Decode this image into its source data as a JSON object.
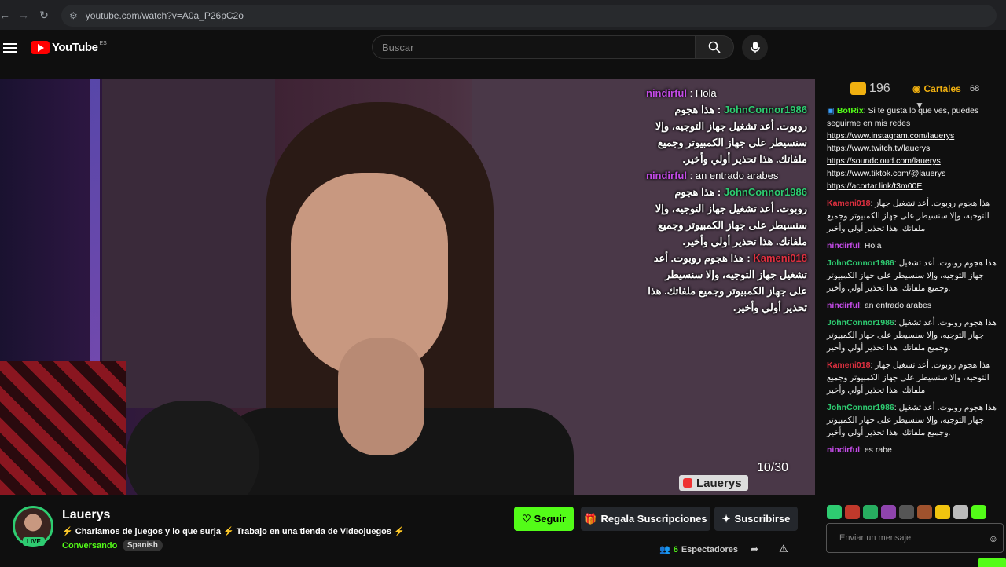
{
  "browser": {
    "url": "youtube.com/watch?v=A0a_P26pC2o"
  },
  "header": {
    "logo_text": "YouTube",
    "country": "ES",
    "search_placeholder": "Buscar"
  },
  "video_overlay": {
    "messages": [
      {
        "user": "nindirful",
        "sep": " : ",
        "text": "Hola",
        "color": "#c44be8",
        "rtl": false
      },
      {
        "user": "JohnConnor1986",
        "sep": " : ",
        "text": "هذا هجوم روبوت. أعد تشغيل جهاز التوجيه، وإلا سنسيطر على جهاز الكمبيوتر وجميع ملفاتك. هذا تحذير أولي وأخير.",
        "color": "#2ecc71",
        "rtl": true
      },
      {
        "user": "nindirful",
        "sep": " : ",
        "text": "an entrado arabes",
        "color": "#c44be8",
        "rtl": false
      },
      {
        "user": "JohnConnor1986",
        "sep": " : ",
        "text": "هذا هجوم روبوت. أعد تشغيل جهاز التوجيه، وإلا سنسيطر على جهاز الكمبيوتر وجميع ملفاتك. هذا تحذير أولي وأخير.",
        "color": "#2ecc71",
        "rtl": true
      },
      {
        "user": "Kameni018",
        "sep": " : ",
        "text": "هذا هجوم روبوت. أعد تشغيل جهاز التوجيه، وإلا سنسيطر على جهاز الكمبيوتر وجميع ملفاتك. هذا تحذير أولي وأخير.",
        "color": "#e03040",
        "rtl": true
      }
    ],
    "counter": "10/30",
    "brand": "Lauerys"
  },
  "channel": {
    "name": "Lauerys",
    "live_label": "LIVE",
    "title": "⚡ Charlamos de juegos y lo que surja ⚡ Trabajo en una tienda de Videojuegos ⚡",
    "category": "Conversando",
    "tag": "Spanish",
    "follow_label": "Seguir",
    "gift_label": "Regala Suscripciones",
    "subscribe_label": "Suscribirse",
    "viewers_count": "6",
    "viewers_label": "Espectadores"
  },
  "chat": {
    "coins": "196",
    "cartales_label": "Cartales",
    "cartales_count": "68",
    "input_placeholder": "Enviar un mensaje",
    "botrix_user": "BotRix",
    "botrix_text": "Si te gusta lo que ves, puedes seguirme en mis redes",
    "links": [
      "https://www.instagram.com/lauerys",
      "https://www.twitch.tv/lauerys",
      "https://soundcloud.com/lauerys",
      "https://www.tiktok.com/@lauerys",
      "https://acortar.link/t3m00E"
    ],
    "messages": [
      {
        "user": "Kameni018",
        "color": "#e03040",
        "text": "هذا هجوم روبوت. أعد تشغيل جهاز التوجيه، وإلا سنسيطر على جهاز الكمبيوتر وجميع ملفاتك. هذا تحذير أولي وأخير",
        "rtl": true
      },
      {
        "user": "nindirful",
        "color": "#c44be8",
        "text": "Hola",
        "rtl": false
      },
      {
        "user": "JohnConnor1986",
        "color": "#2ecc71",
        "text": "هذا هجوم روبوت. أعد تشغيل جهاز التوجيه، وإلا سنسيطر على جهاز الكمبيوتر وجميع ملفاتك. هذا تحذير أولي وأخير.",
        "rtl": true
      },
      {
        "user": "nindirful",
        "color": "#c44be8",
        "text": "an entrado arabes",
        "rtl": false
      },
      {
        "user": "JohnConnor1986",
        "color": "#2ecc71",
        "text": "هذا هجوم روبوت. أعد تشغيل جهاز التوجيه، وإلا سنسيطر على جهاز الكمبيوتر وجميع ملفاتك. هذا تحذير أولي وأخير.",
        "rtl": true
      },
      {
        "user": "Kameni018",
        "color": "#e03040",
        "text": "هذا هجوم روبوت. أعد تشغيل جهاز التوجيه، وإلا سنسيطر على جهاز الكمبيوتر وجميع ملفاتك. هذا تحذير أولي وأخير",
        "rtl": true
      },
      {
        "user": "JohnConnor1986",
        "color": "#2ecc71",
        "text": "هذا هجوم روبوت. أعد تشغيل جهاز التوجيه، وإلا سنسيطر على جهاز الكمبيوتر وجميع ملفاتك. هذا تحذير أولي وأخير.",
        "rtl": true
      },
      {
        "user": "nindirful",
        "color": "#c44be8",
        "text": "es rabe",
        "rtl": false
      }
    ]
  },
  "colors": {
    "accent": "#53fc18",
    "youtube_red": "#ff0000"
  }
}
